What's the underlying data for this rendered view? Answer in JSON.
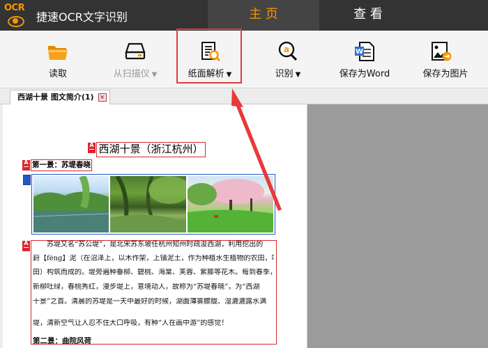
{
  "titlebar": {
    "logo_text": "OCR",
    "app_title": "捷速OCR文字识别",
    "tabs": [
      {
        "label": "主 页",
        "active": true
      },
      {
        "label": "查 看",
        "active": false
      }
    ],
    "accent_color": "#f39800"
  },
  "toolbar": {
    "read": {
      "label": "读取",
      "icon": "folder-icon"
    },
    "scan": {
      "label": "从扫描仪",
      "icon": "scanner-icon",
      "enabled": false
    },
    "parse": {
      "label": "纸面解析",
      "icon": "document-magnifier-icon",
      "highlighted": true
    },
    "recognize": {
      "label": "识别",
      "icon": "recognize-magnifier-icon"
    },
    "save_word": {
      "label": "保存为Word",
      "icon": "word-file-icon"
    },
    "save_image": {
      "label": "保存为图片",
      "icon": "image-file-icon"
    },
    "dropdown_glyph": "▼",
    "highlight_color": "#e03a3a"
  },
  "doc_tab": {
    "label": "西湖十景 图文简介(1)",
    "close_glyph": "×"
  },
  "document": {
    "mark_glyph": "A",
    "title": "西湖十景（浙江杭州）",
    "scene1_heading": "第一景：苏堤春晓",
    "paragraph_lines": [
      "苏堤又名“苏公堤”，是北宋苏东坡任杭州知州时疏浚西湖，利用挖出的",
      "葑【fèng】泥（在沼泽上，以木作架，上铺泥土，作为种植水生植物的农田，叫葑",
      "田）构筑而成的。堤旁遍种垂柳、碧桃、海棠、芙蓉、紫藤等花木。每到春季，",
      "新柳吐绿，春桃秀红，漫步堤上，意境动人，故称为“苏堤春晓”，为“西湖",
      "十景”之首。清晨的苏堤是一天中最好的时候，湖面薄雾朦胧、湿漉漉露水满",
      "堤，清新空气让人忍不住大口呼吸，有种“人在画中游”的感觉！"
    ],
    "scene2_heading": "第二景：曲院风荷"
  }
}
